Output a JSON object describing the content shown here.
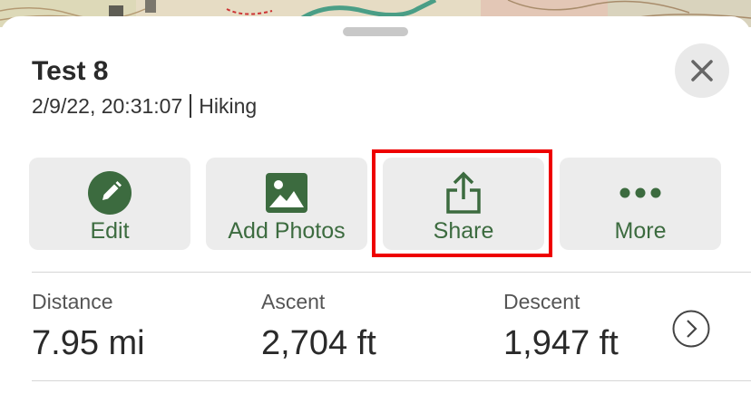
{
  "activity": {
    "title": "Test 8",
    "datetime": "2/9/22, 20:31:07",
    "type": "Hiking"
  },
  "actions": [
    {
      "label": "Edit",
      "icon": "pencil-icon"
    },
    {
      "label": "Add Photos",
      "icon": "photo-icon"
    },
    {
      "label": "Share",
      "icon": "share-icon",
      "highlighted": true
    },
    {
      "label": "More",
      "icon": "more-dots-icon"
    }
  ],
  "stats": [
    {
      "label": "Distance",
      "value": "7.95 mi"
    },
    {
      "label": "Ascent",
      "value": "2,704 ft"
    },
    {
      "label": "Descent",
      "value": "1,947 ft"
    }
  ],
  "colors": {
    "accent": "#3c6b3f",
    "button_bg": "#ececec",
    "highlight_border": "#ee0000",
    "route_line": "#4a9e86"
  }
}
